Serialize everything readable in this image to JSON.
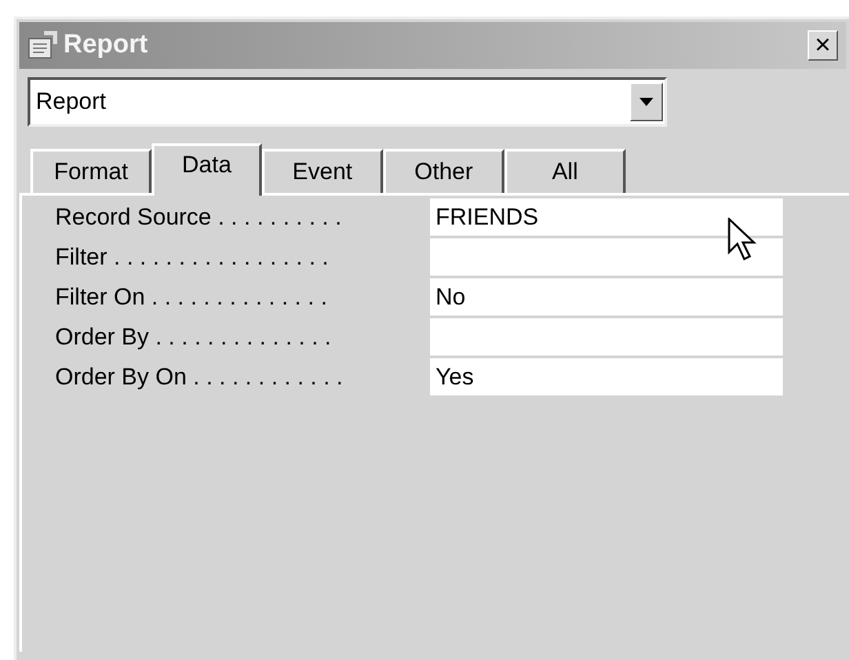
{
  "window": {
    "title": "Report",
    "close": "×"
  },
  "object_selector": {
    "value": "Report"
  },
  "tabs": [
    {
      "label": "Format",
      "selected": false
    },
    {
      "label": "Data",
      "selected": true
    },
    {
      "label": "Event",
      "selected": false
    },
    {
      "label": "Other",
      "selected": false
    },
    {
      "label": "All",
      "selected": false
    }
  ],
  "properties": [
    {
      "label": "Record Source . . . . . . . . . .",
      "value": "FRIENDS"
    },
    {
      "label": "Filter . . . . . . . . . . . . . . . . ."
    },
    {
      "label": "Filter On . . . . . . . . . . . . . .",
      "value": "No"
    },
    {
      "label": "Order By . . . . . . . . . . . . . ."
    },
    {
      "label": "Order By On . . . . . . . . . . . .",
      "value": "Yes"
    }
  ]
}
